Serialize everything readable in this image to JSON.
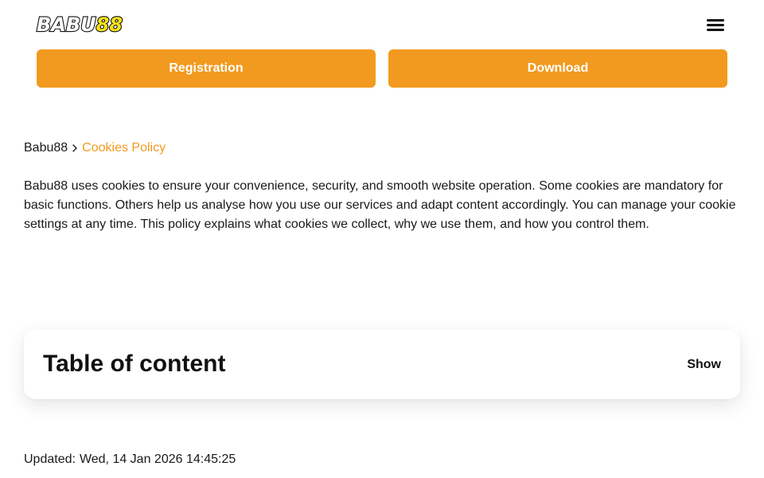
{
  "header": {
    "logo_part1": "BABU",
    "logo_part2": "88",
    "menu_icon": "hamburger-menu-icon"
  },
  "cta": {
    "registration_label": "Registration",
    "download_label": "Download",
    "accent_color": "#f29a1f"
  },
  "breadcrumb": {
    "home": "Babu88",
    "separator_icon": "chevron-right-icon",
    "current": "Cookies Policy"
  },
  "intro": {
    "text": "Babu88 uses cookies to ensure your convenience, security, and smooth website operation. Some cookies are mandatory for basic functions. Others help us analyse how you use our services and adapt content accordingly. You can manage your cookie settings at any time. This policy explains what cookies we collect, why we use them, and how you control them."
  },
  "toc": {
    "title": "Table of content",
    "toggle_label": "Show"
  },
  "updated": {
    "label": "Updated:",
    "value": "Wed, 14 Jan 2026 14:45:25"
  }
}
